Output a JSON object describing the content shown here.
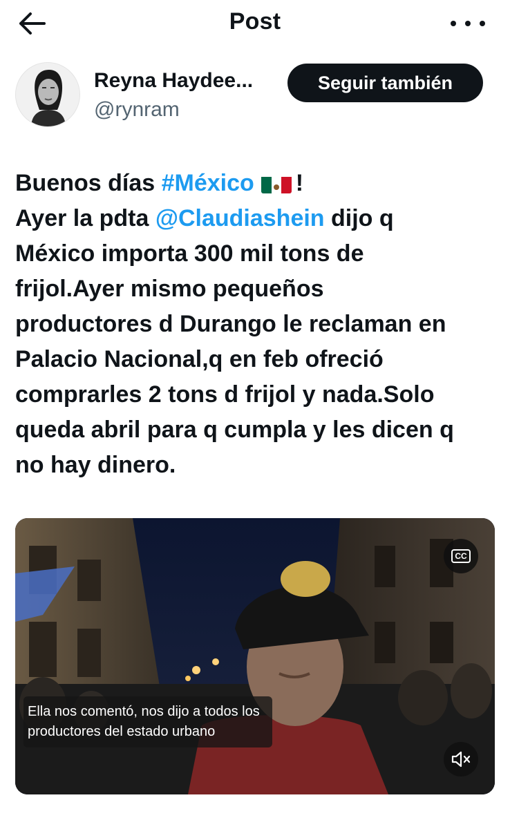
{
  "header": {
    "title": "Post",
    "back_icon": "arrow-left-icon",
    "more_icon": "more-horizontal-icon"
  },
  "author": {
    "name": "Reyna Haydee...",
    "handle": "@rynram",
    "follow_label": "Seguir también"
  },
  "post": {
    "lines": [
      [
        {
          "text": "Buenos días "
        },
        {
          "text": "#México",
          "link": true
        },
        {
          "flag": "mexico-flag-emoji"
        },
        {
          "text": "!"
        }
      ],
      [
        {
          "text": "Ayer la pdta "
        },
        {
          "text": "@Claudiashein",
          "link": true
        },
        {
          "text": " dijo q"
        }
      ],
      [
        {
          "text": "México importa 300 mil tons de"
        }
      ],
      [
        {
          "text": "frijol.Ayer mismo pequeños"
        }
      ],
      [
        {
          "text": "productores d Durango le reclaman en"
        }
      ],
      [
        {
          "text": "Palacio Nacional,q en feb ofreció"
        }
      ],
      [
        {
          "text": "comprarles 2 tons d frijol y nada.Solo"
        }
      ],
      [
        {
          "text": "queda abril para q cumpla y les dicen q"
        }
      ],
      [
        {
          "text": "no hay dinero."
        }
      ]
    ]
  },
  "video": {
    "subtitle": "Ella nos comentó, nos dijo a todos los productores del estado urbano",
    "cc_label": "CC",
    "cc_icon": "closed-captions-icon",
    "mute_icon": "speaker-muted-icon"
  },
  "colors": {
    "text": "#0f1419",
    "secondary": "#536471",
    "link": "#1d9bf0",
    "button_bg": "#0f1419"
  }
}
